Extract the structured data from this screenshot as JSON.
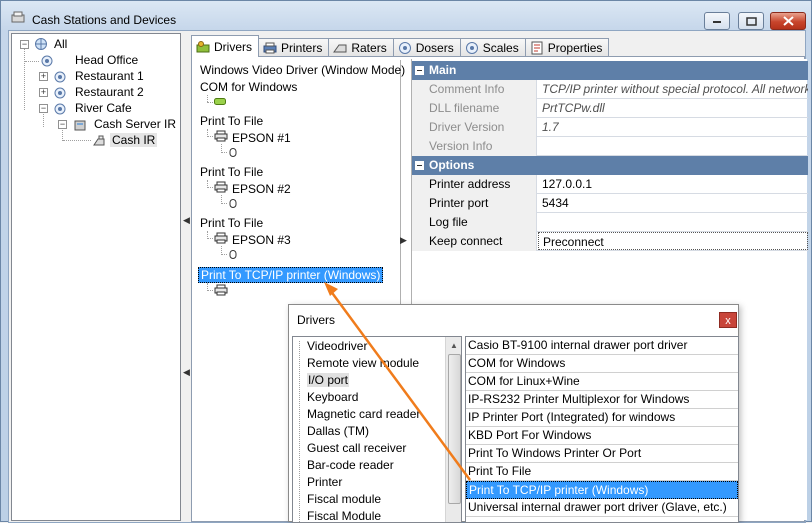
{
  "window": {
    "title": "Cash Stations and Devices"
  },
  "left_tree": {
    "items": [
      {
        "label": "All"
      },
      {
        "label": "Head Office"
      },
      {
        "label": "Restaurant 1"
      },
      {
        "label": "Restaurant 2"
      },
      {
        "label": "River Cafe"
      },
      {
        "label": "Cash Server IR"
      },
      {
        "label": "Cash IR"
      }
    ]
  },
  "tabs": [
    {
      "label": "Drivers"
    },
    {
      "label": "Printers"
    },
    {
      "label": "Raters"
    },
    {
      "label": "Dosers"
    },
    {
      "label": "Scales"
    },
    {
      "label": "Properties"
    }
  ],
  "driver_tree": {
    "items": [
      {
        "label": "Windows Video Driver (Window Mode)"
      },
      {
        "label": "COM for Windows"
      },
      {
        "label": "Print To File"
      },
      {
        "label": "EPSON #1"
      },
      {
        "label": "Print To File"
      },
      {
        "label": "EPSON #2"
      },
      {
        "label": "Print To File"
      },
      {
        "label": "EPSON #3"
      },
      {
        "label": "Print To TCP/IP printer (Windows)"
      }
    ]
  },
  "properties": {
    "main_section": "Main",
    "options_section": "Options",
    "main_rows": [
      {
        "key": "Comment Info",
        "value": "TCP/IP printer without special protocol. All network inpu"
      },
      {
        "key": "DLL filename",
        "value": "PrtTCPw.dll"
      },
      {
        "key": "Driver Version",
        "value": "1.7"
      },
      {
        "key": "Version Info",
        "value": ""
      }
    ],
    "option_rows": [
      {
        "key": "Printer address",
        "value": "127.0.0.1"
      },
      {
        "key": "Printer port",
        "value": "5434"
      },
      {
        "key": "Log file",
        "value": ""
      },
      {
        "key": "Keep connect",
        "value": "Preconnect"
      }
    ]
  },
  "drivers_dialog": {
    "title": "Drivers",
    "close": "x",
    "categories": [
      "Videodriver",
      "Remote view module",
      "I/O port",
      "Keyboard",
      "Magnetic card reader",
      "Dallas (TM)",
      "Guest call receiver",
      "Bar-code reader",
      "Printer",
      "Fiscal module",
      "Fiscal Module"
    ],
    "drivers": [
      "Casio BT-9100 internal drawer port driver",
      "COM for Windows",
      "COM for Linux+Wine",
      "IP-RS232 Printer Multiplexor for Windows",
      "IP Printer Port (Integrated) for windows",
      "KBD Port For Windows",
      "Print To Windows Printer Or Port",
      "Print To File",
      "Print To TCP/IP printer (Windows)",
      "Universal internal drawer port driver (Glave, etc.)"
    ]
  },
  "colors": {
    "selection": "#3399ff",
    "section_header": "#5e7fa8",
    "arrow": "#f07c1c"
  }
}
